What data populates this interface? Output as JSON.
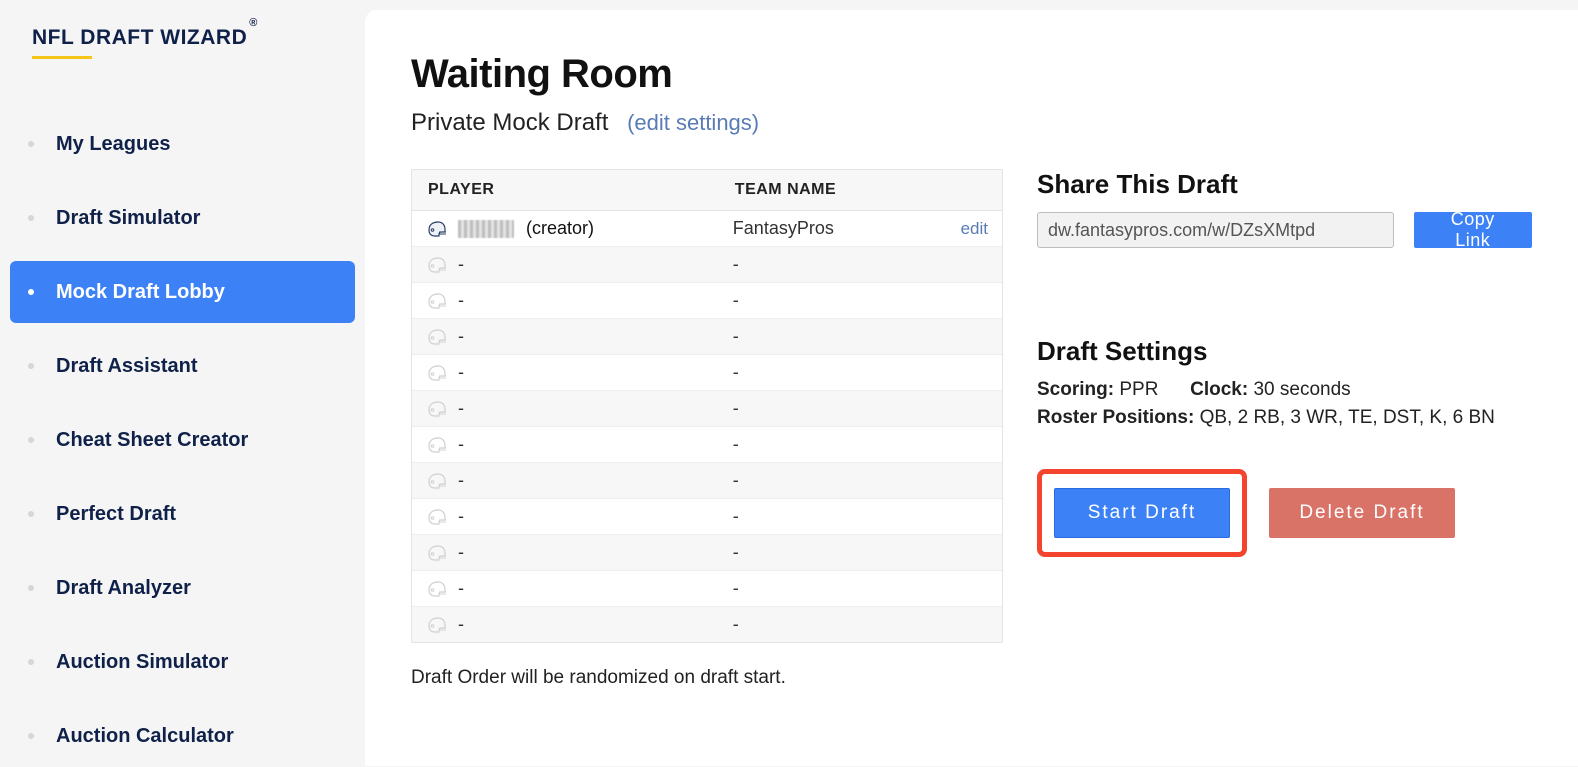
{
  "brand": {
    "title": "NFL DRAFT WIZARD",
    "reg": "®"
  },
  "sidebar": {
    "items": [
      {
        "label": "My Leagues",
        "active": false
      },
      {
        "label": "Draft Simulator",
        "active": false
      },
      {
        "label": "Mock Draft Lobby",
        "active": true
      },
      {
        "label": "Draft Assistant",
        "active": false
      },
      {
        "label": "Cheat Sheet Creator",
        "active": false
      },
      {
        "label": "Perfect Draft",
        "active": false
      },
      {
        "label": "Draft Analyzer",
        "active": false
      },
      {
        "label": "Auction Simulator",
        "active": false
      },
      {
        "label": "Auction Calculator",
        "active": false
      }
    ]
  },
  "header": {
    "title": "Waiting Room",
    "subtitle": "Private Mock Draft",
    "edit_settings": "(edit settings)"
  },
  "table": {
    "col_player": "PLAYER",
    "col_team": "TEAM NAME",
    "rows": [
      {
        "player_redacted": true,
        "creator_suffix": "(creator)",
        "team": "FantasyPros",
        "editable": true
      },
      {
        "player": "-",
        "team": "-"
      },
      {
        "player": "-",
        "team": "-"
      },
      {
        "player": "-",
        "team": "-"
      },
      {
        "player": "-",
        "team": "-"
      },
      {
        "player": "-",
        "team": "-"
      },
      {
        "player": "-",
        "team": "-"
      },
      {
        "player": "-",
        "team": "-"
      },
      {
        "player": "-",
        "team": "-"
      },
      {
        "player": "-",
        "team": "-"
      },
      {
        "player": "-",
        "team": "-"
      },
      {
        "player": "-",
        "team": "-"
      }
    ]
  },
  "share": {
    "title": "Share This Draft",
    "url": "dw.fantasypros.com/w/DZsXMtpd",
    "copy_label": "Copy Link"
  },
  "settings": {
    "title": "Draft Settings",
    "scoring_label": "Scoring:",
    "scoring_value": "PPR",
    "clock_label": "Clock:",
    "clock_value": "30 seconds",
    "roster_label": "Roster Positions:",
    "roster_value": "QB, 2 RB, 3 WR, TE, DST, K, 6 BN"
  },
  "actions": {
    "start": "Start Draft",
    "delete": "Delete Draft"
  },
  "footer_note": "Draft Order will be randomized on draft start.",
  "edit_label": "edit"
}
